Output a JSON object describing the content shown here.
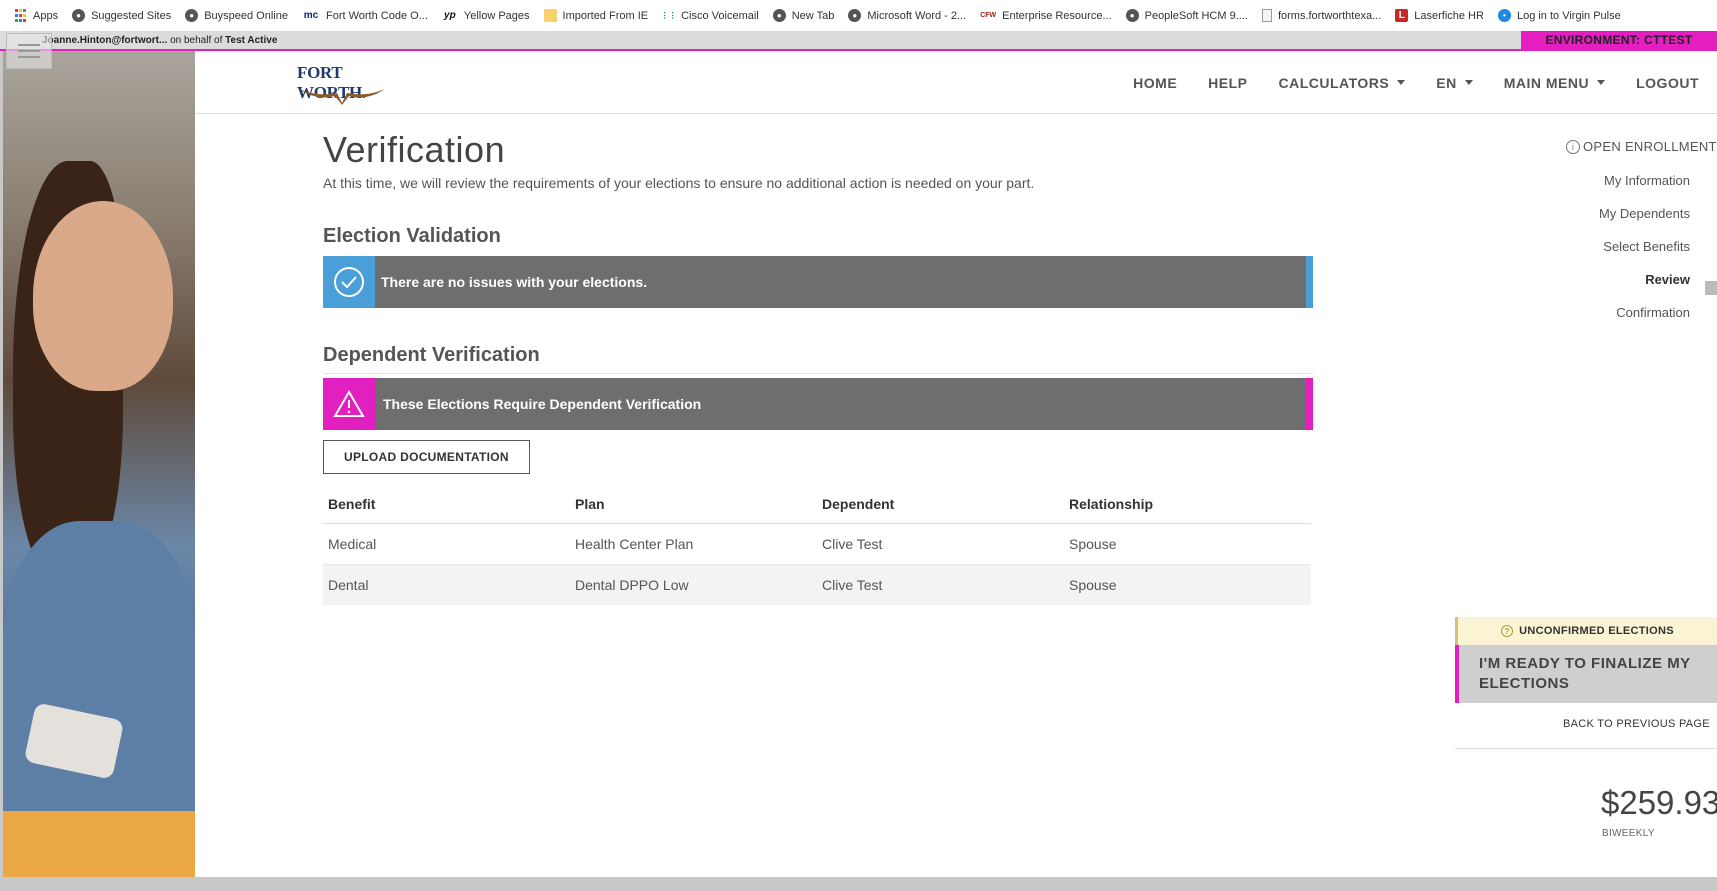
{
  "bookmarks": [
    {
      "label": "Apps",
      "icon": "apps-grid-icon"
    },
    {
      "label": "Suggested Sites",
      "icon": "globe-icon"
    },
    {
      "label": "Buyspeed Online",
      "icon": "globe-icon"
    },
    {
      "label": "Fort Worth Code O...",
      "icon": "mc-icon",
      "glyph": "mc"
    },
    {
      "label": "Yellow Pages",
      "icon": "yp-icon",
      "glyph": "yp"
    },
    {
      "label": "Imported From IE",
      "icon": "folder-icon"
    },
    {
      "label": "Cisco Voicemail",
      "icon": "cisco-icon"
    },
    {
      "label": "New Tab",
      "icon": "globe-icon"
    },
    {
      "label": "Microsoft Word - 2...",
      "icon": "globe-icon"
    },
    {
      "label": "Enterprise Resource...",
      "icon": "cfw-icon",
      "glyph": "CFW"
    },
    {
      "label": "PeopleSoft HCM 9....",
      "icon": "globe-icon"
    },
    {
      "label": "forms.fortworthtexa...",
      "icon": "document-icon"
    },
    {
      "label": "Laserfiche HR",
      "icon": "laserfiche-icon",
      "glyph": "L"
    },
    {
      "label": "Log in to Virgin Pulse",
      "icon": "virgin-pulse-icon"
    }
  ],
  "env_bar": {
    "user": "Joanne.Hinton@fortwort...",
    "behalf_prefix": "on behalf of",
    "behalf_user": "Test Active",
    "environment": "ENVIRONMENT: CTTEST"
  },
  "header": {
    "logo_text": "FORT WORTH.",
    "nav": {
      "home": "HOME",
      "help": "HELP",
      "calculators": "CALCULATORS",
      "language": "EN",
      "main_menu": "MAIN MENU",
      "logout": "LOGOUT"
    }
  },
  "page": {
    "title": "Verification",
    "description": "At this time, we will review the requirements of your elections to ensure no additional action is needed on your part.",
    "election_validation": {
      "heading": "Election Validation",
      "message": "There are no issues with your elections."
    },
    "dependent_verification": {
      "heading": "Dependent Verification",
      "message": "These Elections Require Dependent Verification",
      "upload_button": "UPLOAD DOCUMENTATION",
      "columns": [
        "Benefit",
        "Plan",
        "Dependent",
        "Relationship"
      ],
      "rows": [
        [
          "Medical",
          "Health Center Plan",
          "Clive Test",
          "Spouse"
        ],
        [
          "Dental",
          "Dental DPPO Low",
          "Clive Test",
          "Spouse"
        ]
      ]
    }
  },
  "sidebar": {
    "open_enrollment": "OPEN ENROLLMENT",
    "steps": [
      "My Information",
      "My Dependents",
      "Select Benefits",
      "Review",
      "Confirmation"
    ],
    "active_step": "Review",
    "unconfirmed_label": "UNCONFIRMED ELECTIONS",
    "finalize_button": "I'M READY TO FINALIZE MY ELECTIONS",
    "back_link": "BACK TO PREVIOUS PAGE",
    "total": "$259.93",
    "frequency": "BIWEEKLY"
  },
  "colors": {
    "accent_magenta": "#e21fbf",
    "accent_blue": "#4a9fd8",
    "banner_gray": "#6e6e6e",
    "logo_navy": "#1d3b6a"
  }
}
